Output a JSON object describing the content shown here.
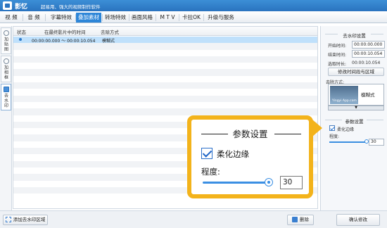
{
  "app": {
    "name": "影忆",
    "subtitle": "超易用、强大的视频制作软件",
    "brand_color": "#2a73bf",
    "icon": "app-logo-icon"
  },
  "menu": {
    "items": [
      {
        "label": "视 频",
        "active": false
      },
      {
        "label": "音 频",
        "active": false
      },
      {
        "label": "字幕特效",
        "active": false
      },
      {
        "label": "叠加素材",
        "active": true
      },
      {
        "label": "转场特效",
        "active": false
      },
      {
        "label": "画面风格",
        "active": false
      },
      {
        "label": "M T V",
        "active": false
      },
      {
        "label": "卡拉OK",
        "active": false
      },
      {
        "label": "升级与服务",
        "active": false
      }
    ]
  },
  "sidetabs": [
    {
      "label": "加贴图",
      "icon": "sticker-icon",
      "active": false
    },
    {
      "label": "加相框",
      "icon": "frame-icon",
      "active": false
    },
    {
      "label": "去水印",
      "icon": "watermark-icon",
      "active": true
    }
  ],
  "table": {
    "headers": [
      "状态",
      "在最终影片中的时间",
      "去除方式"
    ],
    "rows": [
      {
        "time": "00:00:00.000 ～ 00:00:10.054",
        "method": "模糊式",
        "selected": true
      }
    ],
    "empty_rows": 24
  },
  "bottom": {
    "add_label": "添加去水印区域",
    "delete_label": "删除",
    "confirm_label": "确认修改"
  },
  "right_panel": {
    "watermark_settings_title": "去水印设置",
    "start_label": "开始时间:",
    "start_value": "00:00:00.000",
    "end_label": "结束时间:",
    "end_value": "00:00:10.054",
    "selected_label": "选取时长:",
    "selected_value": "00:00:10.054",
    "modify_button": "修改时间段与区域",
    "method_label": "去除方式:",
    "thumb_watermark": "Yingyi App.com",
    "thumb_label": "模糊式",
    "params_title": "参数设置",
    "soften_label": "柔化边缘",
    "soften_checked": true,
    "degree_label": "程度:",
    "degree_value": "30",
    "degree_fraction": 1.0
  },
  "callout": {
    "title": "参数设置",
    "soften_label": "柔化边缘",
    "soften_checked": true,
    "degree_label": "程度:",
    "degree_value": "30",
    "accent_color": "#f3b31b"
  }
}
